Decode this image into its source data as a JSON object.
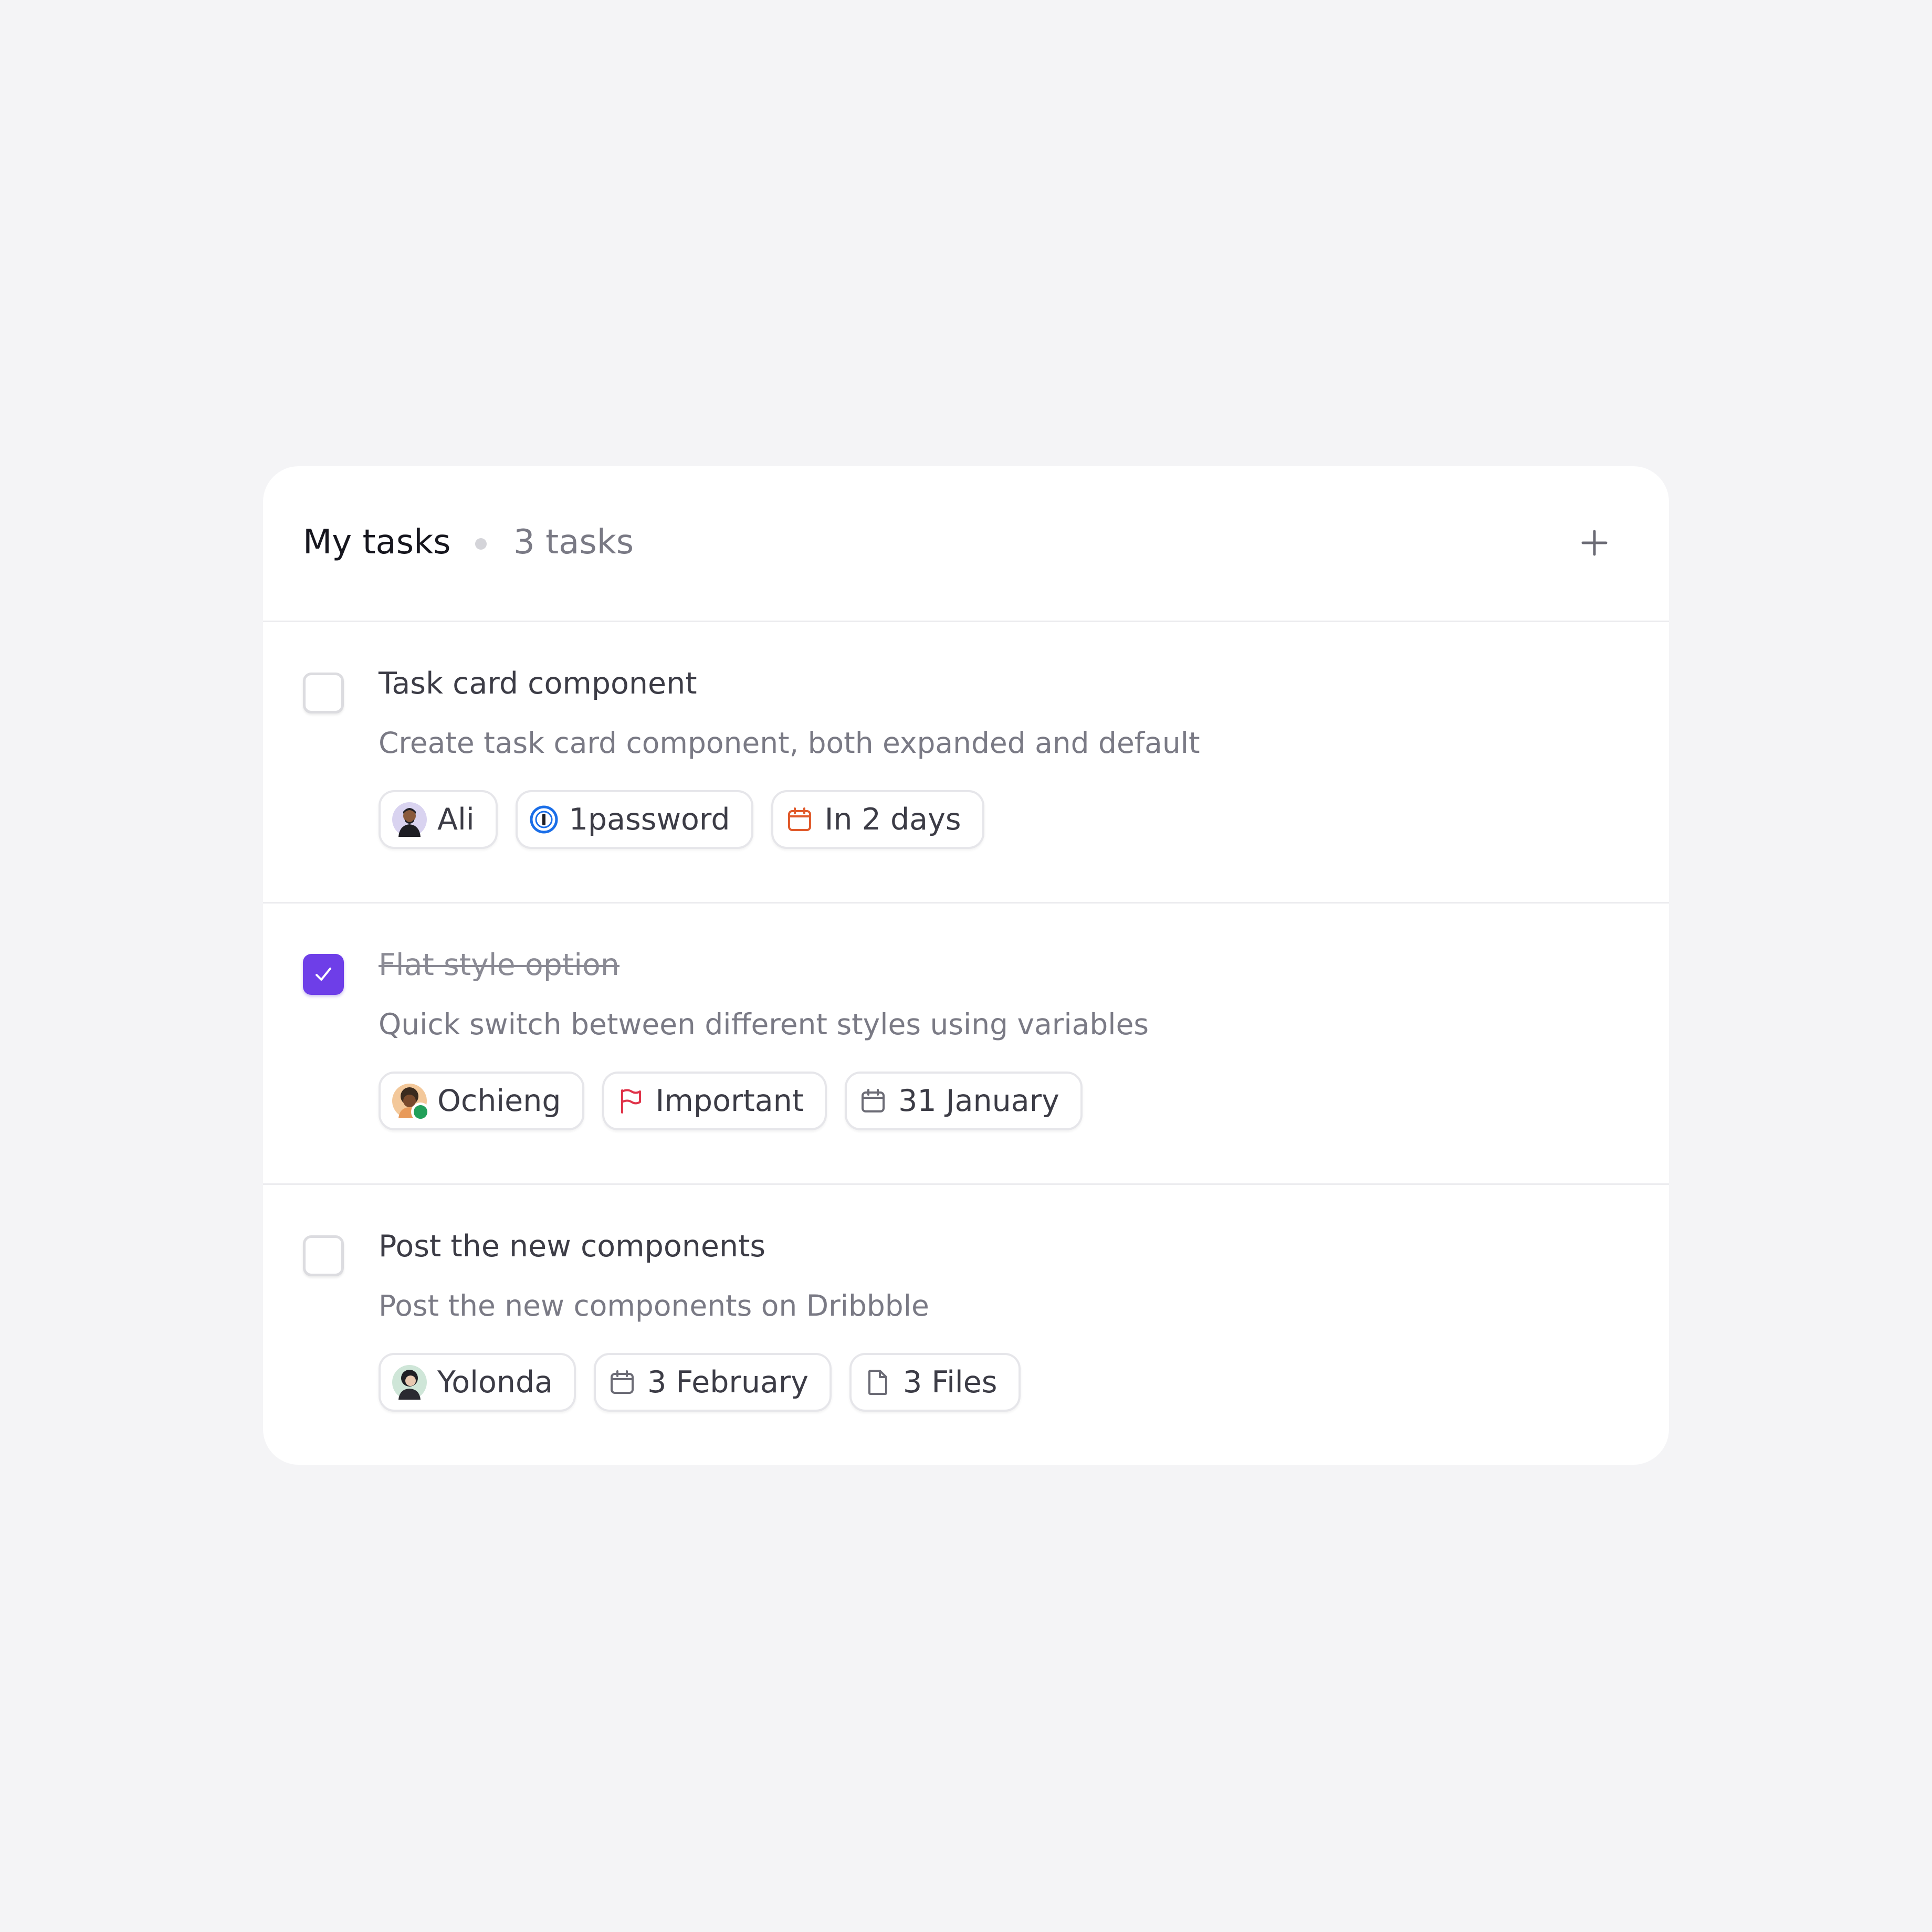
{
  "header": {
    "title": "My tasks",
    "count": "3 tasks"
  },
  "colors": {
    "accent": "#6e3ee8",
    "due_soon": "#e05a2b",
    "important": "#e0344a",
    "online": "#22a05a",
    "onepassword_blue": "#1a6ee8"
  },
  "tasks": [
    {
      "title": "Task card component",
      "description": "Create task card component, both expanded and default",
      "completed": false,
      "pills": {
        "assignee": "Ali",
        "project": "1password",
        "due": "In 2 days"
      },
      "icons": [
        "avatar-ali",
        "onepassword-icon",
        "calendar-icon"
      ]
    },
    {
      "title": "Flat style option",
      "description": "Quick switch between different styles using variables",
      "completed": true,
      "pills": {
        "assignee": "Ochieng",
        "priority": "Important",
        "due": "31 January"
      },
      "icons": [
        "avatar-ochieng",
        "flag-icon",
        "calendar-icon"
      ]
    },
    {
      "title": "Post the new components",
      "description": "Post the new components on Dribbble",
      "completed": false,
      "pills": {
        "assignee": "Yolonda",
        "due": "3 February",
        "files": "3 Files"
      },
      "icons": [
        "avatar-yolonda",
        "calendar-icon",
        "file-icon"
      ]
    }
  ]
}
